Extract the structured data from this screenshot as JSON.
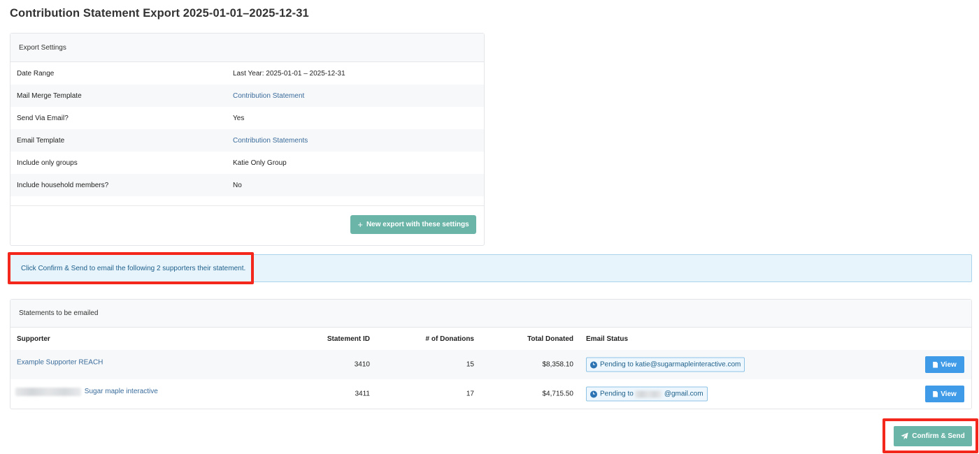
{
  "page": {
    "title": "Contribution Statement Export 2025-01-01–2025-12-31"
  },
  "settings": {
    "header": "Export Settings",
    "rows": [
      {
        "label": "Date Range",
        "value": "Last Year: 2025-01-01 – 2025-12-31"
      },
      {
        "label": "Mail Merge Template",
        "value": "Contribution Statement"
      },
      {
        "label": "Send Via Email?",
        "value": "Yes"
      },
      {
        "label": "Email Template",
        "value": "Contribution Statements"
      },
      {
        "label": "Include only groups",
        "value": "Katie Only Group"
      },
      {
        "label": "Include household members?",
        "value": "No"
      }
    ],
    "new_export_label": "New export with these settings"
  },
  "alert": {
    "text": "Click Confirm & Send to email the following 2 supporters their statement."
  },
  "statements": {
    "header": "Statements to be emailed",
    "columns": [
      "Supporter",
      "Statement ID",
      "# of Donations",
      "Total Donated",
      "Email Status"
    ],
    "rows": [
      {
        "supporter": "Example Supporter REACH",
        "statement_id": "3410",
        "donations": "15",
        "total": "$8,358.10",
        "status_prefix": "Pending to katie@sugarmapleinteractive.com",
        "status_suffix": "",
        "view_label": "View"
      },
      {
        "supporter": "Sugar maple interactive",
        "statement_id": "3411",
        "donations": "17",
        "total": "$4,715.50",
        "status_prefix": "Pending to",
        "status_suffix": "@gmail.com",
        "view_label": "View"
      }
    ]
  },
  "actions": {
    "confirm_label": "Confirm & Send"
  },
  "colors": {
    "highlight": "#f3271c",
    "primary_teal": "#6bb5a8",
    "view_blue": "#3f9be8",
    "link": "#3a6c9c"
  }
}
